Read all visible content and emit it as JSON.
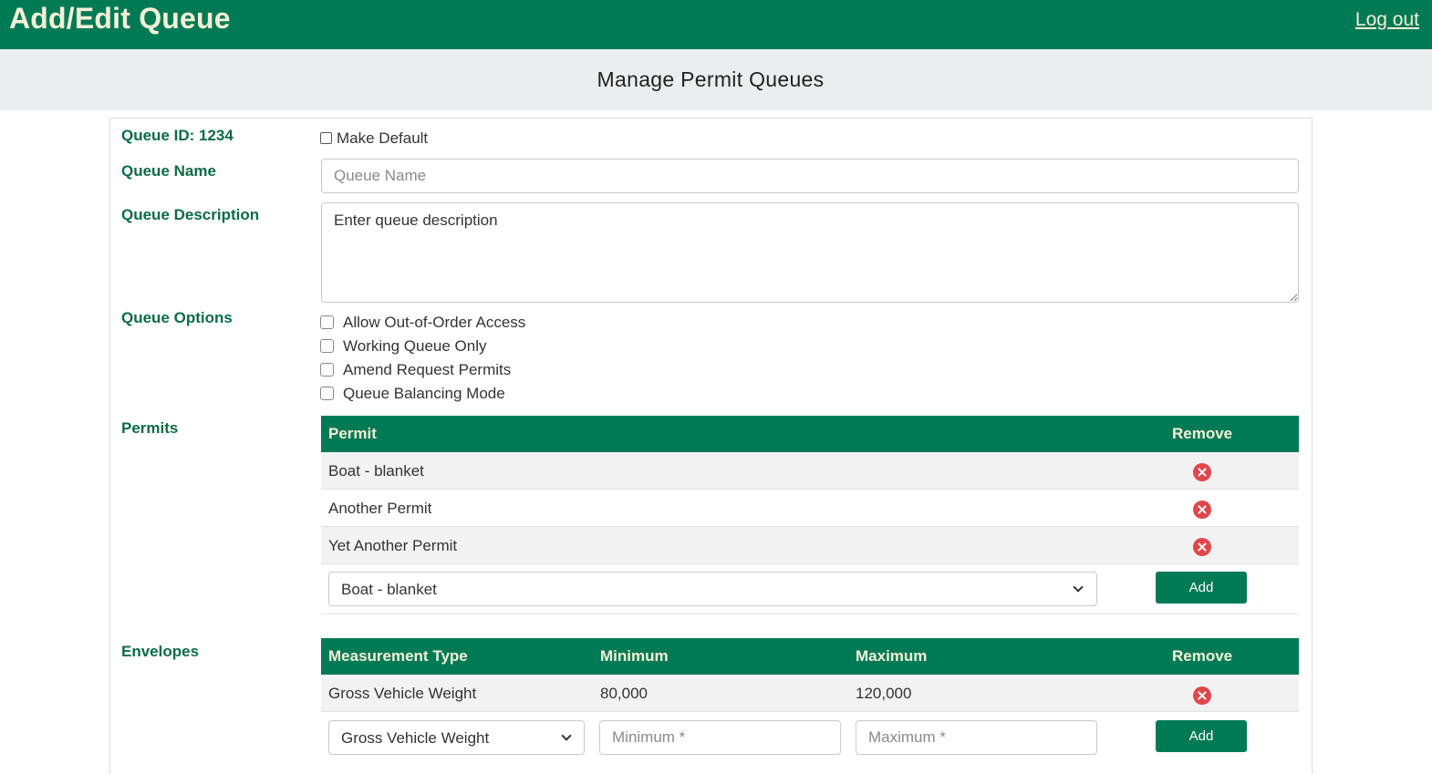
{
  "header": {
    "title": "Add/Edit Queue",
    "logout_label": "Log out"
  },
  "subheader": {
    "title": "Manage Permit Queues"
  },
  "form": {
    "queue_id_label": "Queue ID: 1234",
    "make_default_label": "Make Default",
    "make_default_checked": false,
    "queue_name_label": "Queue Name",
    "queue_name_placeholder": "Queue Name",
    "queue_name_value": "",
    "queue_description_label": "Queue Description",
    "queue_description_value": "Enter queue description",
    "queue_options_label": "Queue Options",
    "queue_options": [
      {
        "label": "Allow Out-of-Order Access",
        "checked": false
      },
      {
        "label": "Working Queue Only",
        "checked": false
      },
      {
        "label": "Amend Request Permits",
        "checked": false
      },
      {
        "label": "Queue Balancing Mode",
        "checked": false
      }
    ]
  },
  "permits": {
    "label": "Permits",
    "columns": {
      "permit": "Permit",
      "remove": "Remove"
    },
    "rows": [
      {
        "permit": "Boat - blanket"
      },
      {
        "permit": "Another Permit"
      },
      {
        "permit": "Yet Another Permit"
      }
    ],
    "selected_permit": "Boat - blanket",
    "add_label": "Add"
  },
  "envelopes": {
    "label": "Envelopes",
    "columns": {
      "measurement_type": "Measurement Type",
      "minimum": "Minimum",
      "maximum": "Maximum",
      "remove": "Remove"
    },
    "rows": [
      {
        "measurement_type": "Gross Vehicle Weight",
        "minimum": "80,000",
        "maximum": "120,000"
      }
    ],
    "selected_measurement_type": "Gross Vehicle Weight",
    "minimum_placeholder": "Minimum *",
    "maximum_placeholder": "Maximum *",
    "add_label": "Add"
  },
  "colors": {
    "brand_green": "#007a55",
    "header_text": "#f4f1d6",
    "label_green": "#0d6b46",
    "remove_red": "#e0474c"
  },
  "icons": {
    "remove": "remove-x-circle-icon",
    "dropdown": "chevron-down-icon"
  }
}
